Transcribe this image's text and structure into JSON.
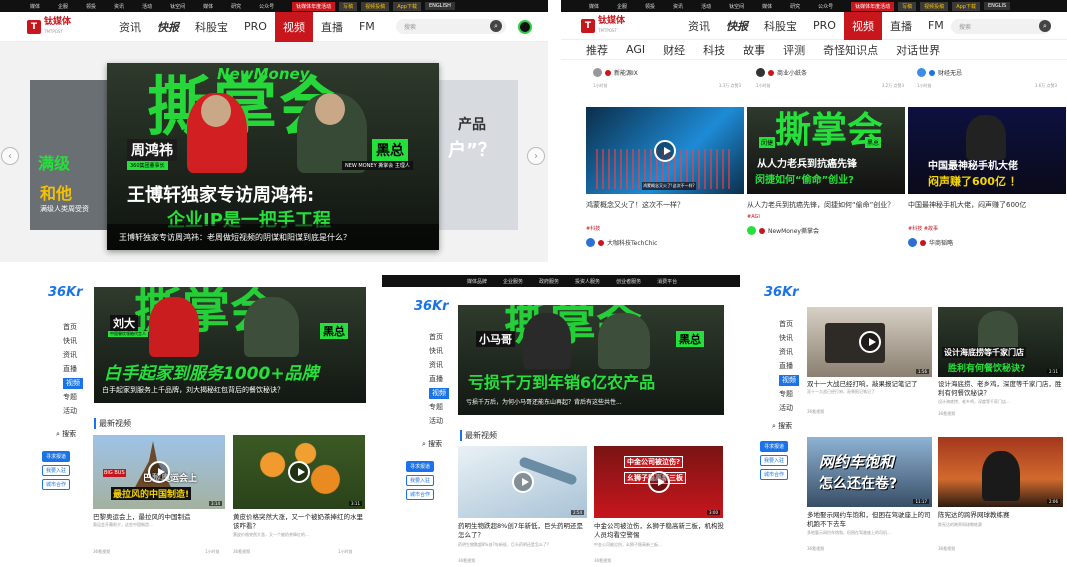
{
  "p1": {
    "topbar": [
      "媒体",
      "企服",
      "领投",
      "资讯",
      "活动",
      "钛空间",
      "媒体",
      "研究",
      "公众号"
    ],
    "topbar_btns": {
      "activity": "钛媒体年度活动",
      "write": "写稿",
      "post": "视频投稿",
      "app": "App下载",
      "lang": "ENGLISH"
    },
    "logo": {
      "cn": "钛媒体",
      "en": "TMTPOST"
    },
    "nav": [
      "资讯",
      "快报",
      "科股宝",
      "PRO",
      "视频",
      "直播",
      "FM"
    ],
    "search_placeholder": "搜索",
    "slide": {
      "brand": "NewMoney",
      "big": "撕掌会",
      "host_left": "周鸿祎",
      "host_left_sub": "360集团董事长",
      "host_right": "黑总",
      "host_right_sub": "NEW MONEY 撕掌会 主理人",
      "headline": "王博轩独家专访周鸿祎:",
      "headline2": "企业IP是一把手工程",
      "caption": "王博轩独家专访周鸿祎：老周做短视频的阴谋和阳谋到底是什么？"
    },
    "left_slide": {
      "t1": "满级",
      "t2": "和他",
      "t3": "满级人类周受资"
    },
    "right_slide": {
      "t1": "产品",
      "t2": "户”？"
    }
  },
  "p2": {
    "topbar": [
      "媒体",
      "企服",
      "领投",
      "资讯",
      "活动",
      "钛空间",
      "媒体",
      "研究",
      "公众号"
    ],
    "topbar_btns": {
      "activity": "钛媒体年度活动",
      "write": "写稿",
      "post": "视频投稿",
      "app": "App下载",
      "lang": "ENGLIS"
    },
    "nav": [
      "资讯",
      "快报",
      "科股宝",
      "PRO",
      "视频",
      "直播",
      "FM"
    ],
    "search_placeholder": "搜索",
    "subnav": [
      "推荐",
      "AGI",
      "财经",
      "科技",
      "故事",
      "评测",
      "奇怪知识点",
      "对话世界"
    ],
    "top_authors": [
      {
        "name": "新能源IX",
        "time": "1小时前",
        "stats": "3.3万  点赞3"
      },
      {
        "name": "商业小纸条",
        "time": "1小时前",
        "stats": "3.2万  点赞3"
      },
      {
        "name": "财经无忌",
        "time": "1小时前",
        "stats": "3.6万  点赞3"
      }
    ],
    "cards": [
      {
        "title": "鸿蒙概念又火了！这次不一样？",
        "tag": "#科技",
        "author": "大咖科技TechChic",
        "overlay": "鸿蒙概念又火了!这次不一样?"
      },
      {
        "title": "从人力老兵到抗癌先锋，闵捷如何“偷命”创业？",
        "tag": "#AGI",
        "author": "NewMoney撕掌会",
        "big": "撕掌会",
        "l1": "从人力老兵到抗癌先锋",
        "l2": "闵捷如何“偷命”创业?",
        "name": "闵捷",
        "host": "黑总"
      },
      {
        "title": "中国最神秘手机大佬，闷声赚了600亿",
        "tag": "#科技  #故事",
        "author": "华商韬略",
        "l1": "中国最神秘手机大佬",
        "l2": "闷声赚了600亿 ！"
      }
    ]
  },
  "p3": {
    "logo": "36Kr",
    "side": [
      "首页",
      "快讯",
      "资讯",
      "直播",
      "视频",
      "专题",
      "活动"
    ],
    "search": "搜索",
    "btns": [
      "寻求报道",
      "我要入驻",
      "城市合作"
    ],
    "hero": {
      "big": "撕掌会",
      "name": "刘大",
      "name_sub": "中国餐饮领袖代言人",
      "host": "黑总",
      "l1": "白手起家到服务1000+品牌",
      "caption": "白手起家到服务上千品牌，刘大揭秘红包背后的餐饮秘诀？"
    },
    "sec": "最新视频",
    "cards": [
      {
        "title": "巴黎奥运会上，最拉风的中国制造",
        "sub": "奥运会开幕前夕，这些中国制造...",
        "author": "36氪视频",
        "time": "1小时前",
        "dur": "3:14",
        "l1": "巴黎奥运会上",
        "l2": "最拉风的中国制造!"
      },
      {
        "title": "黄皮价格突然大涨，又一个被奶茶捧红的水里该咋看？",
        "sub": "黄皮价格突然大涨，又一个被奶茶捧红的...",
        "author": "36氪视频",
        "time": "1小时前",
        "dur": "3:11",
        "l1": "黄皮大涨"
      }
    ]
  },
  "p4": {
    "topbar": [
      "媒体品牌",
      "企业服务",
      "政府服务",
      "投资人服务",
      "创业者服务",
      "消费平台"
    ],
    "logo": "36Kr",
    "side": [
      "首页",
      "快讯",
      "资讯",
      "直播",
      "视频",
      "专题",
      "活动"
    ],
    "search": "搜索",
    "btns": [
      "寻求报道",
      "我要入驻",
      "城市合作"
    ],
    "hero": {
      "big": "撕掌会",
      "name": "小马哥",
      "host": "黑总",
      "l1": "亏损千万到年销6亿农产品",
      "caption": "亏损千万后，为何小马哥还能东山再起？背后有这些共性..."
    },
    "sec": "最新视频",
    "cards": [
      {
        "title": "药明生物跌超8%创7年新低，巨头药明还是怎么了？",
        "sub": "药明生物跌超8%创7年新低，巨头药明还是怎么了?",
        "author": "36氪视频",
        "dur": "2:54"
      },
      {
        "title": "中金公司被泣伤，幺狮子稳高新三板，机构投人员均看空警惕",
        "sub": "中金公司被泣伤，幺狮子稳高新三板...",
        "author": "36氪视频",
        "dur": "3:00",
        "l1": "中金公司被泣伤?",
        "l2": "幺狮子稳高新三板"
      }
    ]
  },
  "p5": {
    "logo": "36Kr",
    "side": [
      "首页",
      "快讯",
      "资讯",
      "直播",
      "视频",
      "专题",
      "活动"
    ],
    "search": "搜索",
    "btns": [
      "寻求报道",
      "我要入驻",
      "城市合作"
    ],
    "cards": [
      {
        "title": "双十一大战已经打响，敲果报记笔记了",
        "sub": "双十一大战已经打响，敲果报记笔记了",
        "author": "36氪视频",
        "dur": "1:56"
      },
      {
        "title": "设计海底捞、老乡鸡，深度等千家门店，胜利有何餐饮秘诀？",
        "sub": "设计海底捞、老乡鸡，深度等千家门店...",
        "author": "36氪视频",
        "dur": "2:11",
        "l1": "设计海底捞等千家门店",
        "l2": "胜利有何餐饮秘诀?"
      },
      {
        "title": "多地娶示网约车饱和，但困在驾驶座上的司机跑不下去车",
        "sub": "多地娶示网约车饱和，但困在驾驶座上的司机...",
        "author": "36氪视频",
        "dur": "11:17",
        "l1": "网约车饱和",
        "l2": "怎么还在卷?"
      },
      {
        "title": "陈宪达的跨界网球教练赛",
        "sub": "陈宪达的跨界网球教练赛",
        "author": "36氪视频",
        "dur": "2:06"
      }
    ]
  },
  "colors": {
    "brand_red": "#c8161d",
    "kr_blue": "#1a73e8",
    "neon_green": "#25e03a"
  }
}
